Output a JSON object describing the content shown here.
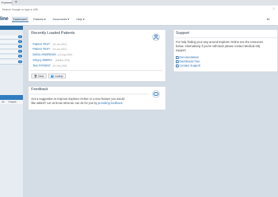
{
  "browser": {
    "tab_title": "Explorer Onl",
    "tab_close": "×",
    "new_tab": "+",
    "address_placeholder": "Search Google or type a URL",
    "bookmark_icon": "star-icon"
  },
  "app": {
    "brand": "line",
    "nav": [
      "Dashboard",
      "Patients ▾",
      "Documents ▾",
      "Help ▾"
    ],
    "user": "Bl"
  },
  "sidebar": {
    "badges": [
      "0",
      "1",
      "0",
      "1",
      "0",
      "0"
    ],
    "sub_tabs": [
      "Jin",
      "Graphs"
    ]
  },
  "recent": {
    "title": "Recently Loaded Patients",
    "patients": [
      {
        "name": "Patient TEST",
        "date": "(31-Jan-2001)"
      },
      {
        "name": "Patient TEST",
        "date": "(31-Jan-2001)"
      },
      {
        "name": "Debra ANDREWS",
        "date": "(13-Aug-1959)"
      },
      {
        "name": "Smyey ZEBRA",
        "date": "(08-Mar-1976)"
      },
      {
        "name": "Test PATIENT",
        "date": "(01-Feb-2016)"
      }
    ],
    "clear_label": "Clear",
    "lookup_label": "Lookup"
  },
  "feedback": {
    "title": "Feedback",
    "text1": "Got a suggestion to improve Explorer Online or a new feature you would",
    "text2_pre": "like added? Let us know what we can do for you by ",
    "link": "providing feedback",
    "text2_post": "."
  },
  "support": {
    "title": "Support",
    "text1": "For help finding your way around Explorer Online see the resources",
    "text2": "below. Alternatively if you're still stuck please contact Medical-Obj",
    "text3": "support.",
    "links": [
      "Documentation",
      "Dashboard Tour",
      "Contact Support"
    ]
  }
}
